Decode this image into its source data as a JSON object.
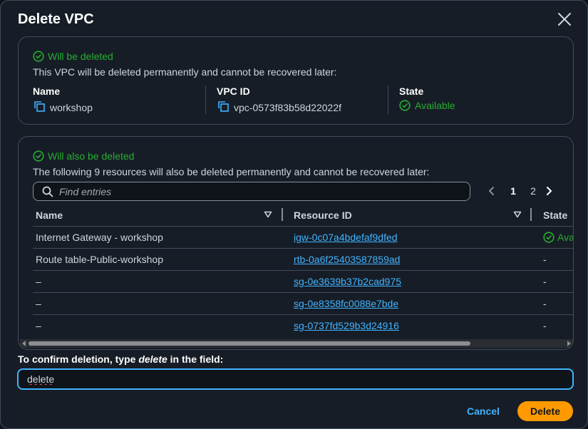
{
  "modal": {
    "title": "Delete VPC",
    "close_icon": "close-icon"
  },
  "vpc_card": {
    "status": "Will be deleted",
    "description": "This VPC will be deleted permanently and cannot be recovered later:",
    "fields": {
      "name_label": "Name",
      "name_value": "workshop",
      "vpc_id_label": "VPC ID",
      "vpc_id_value": "vpc-0573f83b58d22022f",
      "state_label": "State",
      "state_value": "Available"
    }
  },
  "resources_card": {
    "status": "Will also be deleted",
    "description": "The following 9 resources will also be deleted permanently and cannot be recovered later:",
    "search": {
      "placeholder": "Find entries",
      "value": ""
    },
    "pagination": {
      "pages": [
        "1",
        "2"
      ],
      "current": "1"
    },
    "columns": [
      "Name",
      "Resource ID",
      "State"
    ],
    "rows": [
      {
        "name": "Internet Gateway - workshop",
        "resource_id": "igw-0c07a4bdefaf9dfed",
        "state": "Ava",
        "state_ok": true
      },
      {
        "name": "Route table-Public-workshop",
        "resource_id": "rtb-0a6f25403587859ad",
        "state": "-",
        "state_ok": false
      },
      {
        "name": "–",
        "resource_id": "sg-0e3639b37b2cad975",
        "state": "-",
        "state_ok": false
      },
      {
        "name": "–",
        "resource_id": "sg-0e8358fc0088e7bde",
        "state": "-",
        "state_ok": false
      },
      {
        "name": "–",
        "resource_id": "sg-0737fd529b3d24916",
        "state": "-",
        "state_ok": false
      }
    ]
  },
  "confirm": {
    "label_prefix": "To confirm deletion, type ",
    "label_keyword": "delete",
    "label_suffix": " in the field:",
    "value": "delete"
  },
  "footer": {
    "cancel_label": "Cancel",
    "delete_label": "Delete"
  },
  "colors": {
    "success": "#29ad32",
    "link": "#42b4ff",
    "primary_button": "#ff9900"
  }
}
